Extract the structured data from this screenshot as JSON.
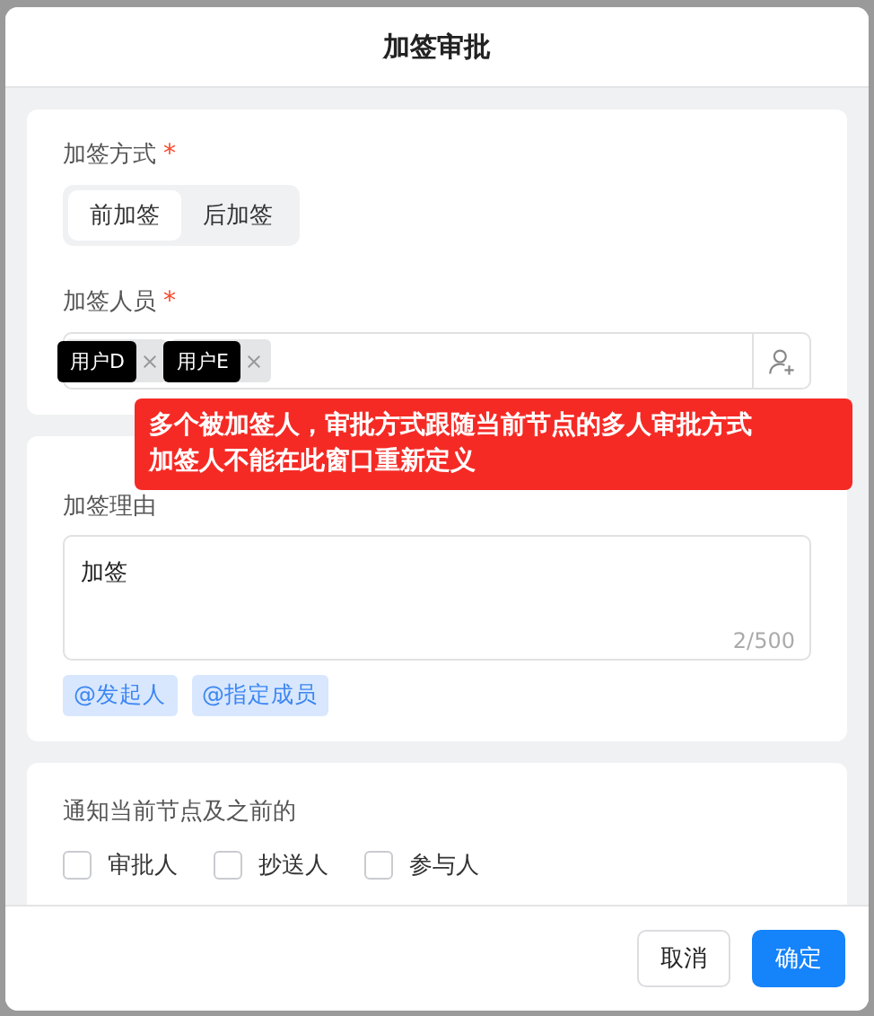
{
  "dialog": {
    "title": "加签审批"
  },
  "method": {
    "label": "加签方式",
    "required_mark": "*",
    "options": [
      {
        "label": "前加签",
        "selected": true
      },
      {
        "label": "后加签",
        "selected": false
      }
    ]
  },
  "members": {
    "label": "加签人员",
    "required_mark": "*",
    "tags": [
      {
        "label": "用户D"
      },
      {
        "label": "用户E"
      }
    ],
    "tooltip": [
      "多个被加签人，审批方式跟随当前节点的多人审批方式",
      "加签人不能在此窗口重新定义"
    ]
  },
  "reason": {
    "label": "加签理由",
    "value": "加签",
    "counter": "2/500",
    "mentions": [
      "@发起人",
      "@指定成员"
    ]
  },
  "notify": {
    "label": "通知当前节点及之前的",
    "options": [
      {
        "label": "审批人",
        "checked": false
      },
      {
        "label": "抄送人",
        "checked": false
      },
      {
        "label": "参与人",
        "checked": false
      }
    ]
  },
  "buttons": [
    {
      "label": "取消",
      "kind": "default"
    },
    {
      "label": "确定",
      "kind": "primary"
    }
  ]
}
